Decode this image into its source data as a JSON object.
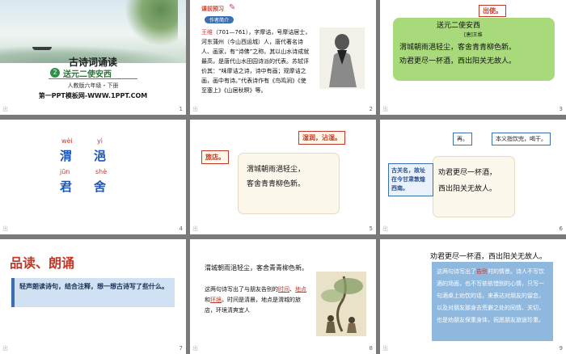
{
  "slides": [
    {
      "number": "1",
      "title": "古诗词诵读",
      "badge": "2",
      "subtitle": "送元二使安西",
      "edition": "人教版六年级・下册",
      "brand": "第一PPT模板网-WWW.1PPT.COM",
      "footer": "出"
    },
    {
      "number": "2",
      "label": "课前预习",
      "chip": "作者简介",
      "bio_name": "王维",
      "bio": "（701—761），字摩诘，号摩诘居士，河东蒲州（今山西运城）人，唐代著名诗人、画家，有“诗佛”之称。其以山水诗成就最高，是唐代山水田园诗派的代表。苏轼评价其：“味摩诘之诗，诗中有画；观摩诘之画，画中有诗。”代表诗作有《鸟鸣涧》《使至塞上》《山居秋暝》等。",
      "footer": "出"
    },
    {
      "number": "3",
      "callout": "出使。",
      "poem_title": "送元二使安西",
      "author": "[唐]王维",
      "line1": "渭城朝雨浥轻尘，客舍青青柳色新。",
      "line2": "劝君更尽一杯酒，西出阳关无故人。",
      "footer": "出"
    },
    {
      "number": "4",
      "chars": [
        {
          "pinyin": "wèi",
          "hanzi": "渭"
        },
        {
          "pinyin": "yì",
          "hanzi": "浥"
        },
        {
          "pinyin": "jūn",
          "hanzi": "君"
        },
        {
          "pinyin": "shè",
          "hanzi": "舍"
        }
      ],
      "footer": "出"
    },
    {
      "number": "5",
      "note_top": "湿润，沾湿。",
      "note_left": "旅店。",
      "verse1": "渭城朝雨浥轻尘，",
      "verse2": "客舍青青柳色新。",
      "footer": "出"
    },
    {
      "number": "6",
      "note1": "再。",
      "note2": "本义指饮完，喝干。",
      "note3": "古关名，故址在今甘肃敦煌西南。",
      "verse1": "劝君更尽一杯酒，",
      "verse2": "西出阳关无故人。",
      "footer": "出"
    },
    {
      "number": "7",
      "heading": "品读、朗诵",
      "task": "轻声朗读诗句，结合注释，想一想古诗写了些什么。",
      "footer": "出"
    },
    {
      "number": "8",
      "verse": "渭城朝雨浥轻尘，客舍青青柳色新。",
      "text_before": "这两句诗写出了与朋友告别的",
      "hl1": "时间",
      "mid1": "、",
      "hl2": "地点",
      "mid2": "和",
      "hl3": "环境",
      "text_after": "。时间是清晨，地点是渭城的旅店，环境清爽宜人",
      "footer": "出"
    },
    {
      "number": "9",
      "verse": "劝君更尽一杯酒，西出阳关无故人。",
      "text_before": "这两句诗写出了",
      "hl": "告别",
      "text_after": "时的情景。诗人不写饮酒的场面，也不写依依惜别的心情，只写一句酒桌上劝饮的话，来表达对朋友的留恋，以及对朋友那身去荒僻之处的同情、关切，也是劝朋友保重身体，祝愿朋友旅途珍重。",
      "footer": "出"
    }
  ]
}
